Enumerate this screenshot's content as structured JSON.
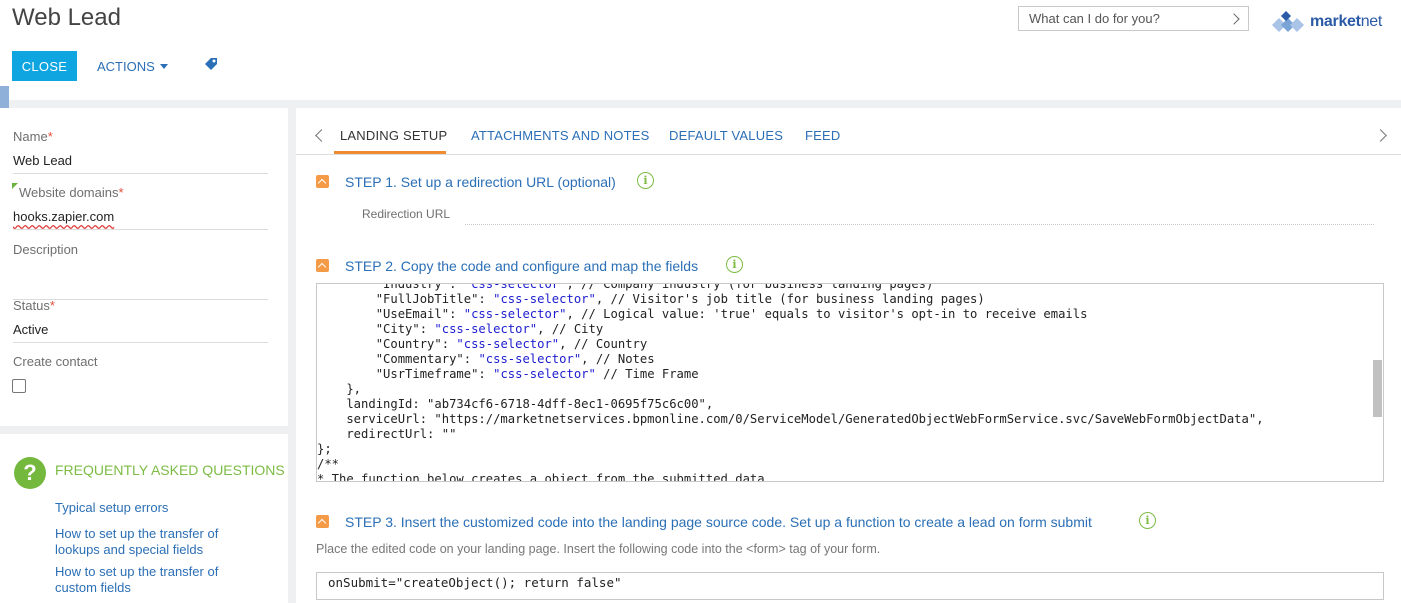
{
  "header": {
    "title": "Web Lead",
    "close_label": "CLOSE",
    "actions_label": "ACTIONS",
    "search_placeholder": "What can I do for you?",
    "logo_text_bold": "market",
    "logo_text_rest": "net"
  },
  "left_panel": {
    "name_label": "Name",
    "name_value": "Web Lead",
    "domains_label": "Website domains",
    "domains_value": "hooks.zapier.com",
    "description_label": "Description",
    "description_value": "",
    "status_label": "Status",
    "status_value": "Active",
    "create_contact_label": "Create contact",
    "required_mark": "*"
  },
  "faq": {
    "title": "FREQUENTLY ASKED QUESTIONS",
    "links": [
      "Typical setup errors",
      "How to set up the transfer of lookups and special fields",
      "How to set up the transfer of custom fields"
    ]
  },
  "tabs": [
    {
      "label": "LANDING SETUP",
      "active": true
    },
    {
      "label": "ATTACHMENTS AND NOTES",
      "active": false
    },
    {
      "label": "DEFAULT VALUES",
      "active": false
    },
    {
      "label": "FEED",
      "active": false
    }
  ],
  "steps": {
    "step1_title": "STEP 1. Set up a redirection URL (optional)",
    "redirection_label": "Redirection URL",
    "step2_title": "STEP 2. Copy the code and configure and map the fields",
    "step3_title": "STEP 3. Insert the customized code into the landing page source code. Set up a function to create a lead on form submit",
    "step3_desc": "Place the edited code on your landing page. Insert the following code into the <form> tag of your form.",
    "onsubmit_code": "onSubmit=\"createObject(); return false\""
  },
  "code_lines": [
    "        \"Industry\": \"css-selector\", // Company industry (for business landing pages)",
    "        \"FullJobTitle\": \"css-selector\", // Visitor's job title (for business landing pages)",
    "        \"UseEmail\": \"css-selector\", // Logical value: 'true' equals to visitor's opt-in to receive emails",
    "        \"City\": \"css-selector\", // City",
    "        \"Country\": \"css-selector\", // Country",
    "        \"Commentary\": \"css-selector\", // Notes",
    "        \"UsrTimeframe\": \"css-selector\" // Time Frame",
    "    },",
    "    landingId: \"ab734cf6-6718-4dff-8ec1-0695f75c6c00\",",
    "    serviceUrl: \"https://marketnetservices.bpmonline.com/0/ServiceModel/GeneratedObjectWebFormService.svc/SaveWebFormObjectData\",",
    "    redirectUrl: \"\"",
    "};",
    "/**",
    "* The function below creates a object from the submitted data."
  ],
  "icons": {
    "info": "i",
    "faq": "?"
  },
  "colors": {
    "accent_blue": "#0fa5e0",
    "link_blue": "#2b6fb6",
    "orange": "#f08b2f",
    "green": "#7cbc45"
  }
}
